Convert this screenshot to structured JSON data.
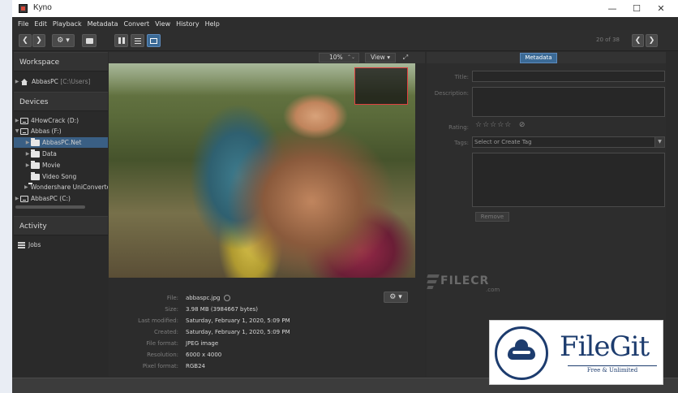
{
  "window": {
    "title": "Kyno",
    "controls": {
      "minimize": "—",
      "maximize": "☐",
      "close": "✕"
    }
  },
  "menu": [
    "File",
    "Edit",
    "Playback",
    "Metadata",
    "Convert",
    "View",
    "History",
    "Help"
  ],
  "toolbar": {
    "back": "❮",
    "forward": "❯",
    "settings": "⚙ ▾",
    "page_count": "20 of 38",
    "prev": "❮",
    "next": "❯"
  },
  "sidebar": {
    "workspace_header": "Workspace",
    "workspace_name": "AbbasPC",
    "workspace_path": "[C:\\Users]",
    "devices_header": "Devices",
    "devices": [
      {
        "label": "4HowCrack (D:)"
      },
      {
        "label": "Abbas (F:)"
      }
    ],
    "folders": [
      {
        "label": "AbbasPC.Net",
        "selected": true
      },
      {
        "label": "Data"
      },
      {
        "label": "Movie"
      },
      {
        "label": "Video Song"
      },
      {
        "label": "Wondershare UniConverter"
      }
    ],
    "drive_c": "AbbasPC (C:)",
    "activity_header": "Activity",
    "jobs": "Jobs"
  },
  "viewer": {
    "zoom": "10%",
    "zoom_spin": "⌃⌄",
    "view_label": "View",
    "expand_icon": "⤢"
  },
  "file_info": {
    "rows": [
      {
        "label": "File:",
        "value": "abbaspc.jpg"
      },
      {
        "label": "Size:",
        "value": "3.98 MB (3984667 bytes)"
      },
      {
        "label": "Last modified:",
        "value": "Saturday, February 1, 2020, 5:09 PM"
      },
      {
        "label": "Created:",
        "value": "Saturday, February 1, 2020, 5:09 PM"
      },
      {
        "label": "File format:",
        "value": "JPEG image"
      },
      {
        "label": "Resolution:",
        "value": "6000 x 4000"
      },
      {
        "label": "Pixel format:",
        "value": "RGB24"
      }
    ],
    "gear": "⚙ ▾"
  },
  "metadata": {
    "tab": "Metadata",
    "title_label": "Title:",
    "description_label": "Description:",
    "rating_label": "Rating:",
    "stars": "☆☆☆☆☆",
    "clear_rating": "⊘",
    "tags_label": "Tags:",
    "tags_placeholder": "Select or Create Tag",
    "remove_button": "Remove"
  },
  "watermarks": {
    "filecr": "FILECR",
    "filecr_sub": ".com",
    "filegit": "FileGit",
    "filegit_sub": "Free & Unlimited"
  },
  "colors": {
    "accent": "#3b6a96",
    "background": "#2b2b2b",
    "overview_border": "#e04040",
    "filegit_navy": "#1d3c6e"
  }
}
